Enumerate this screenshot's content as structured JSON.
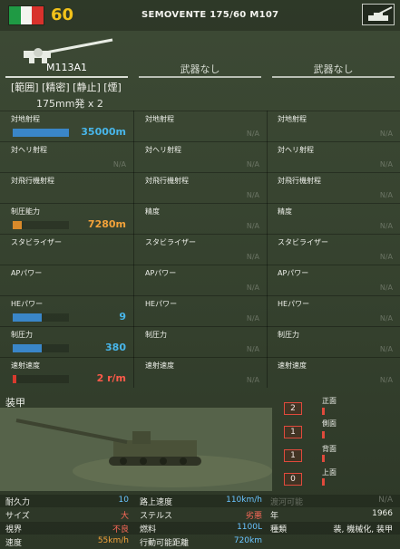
{
  "colors": {
    "accent_blue": "#3a86c8",
    "accent_orange": "#d98a2a",
    "accent_red": "#d83a2e",
    "value_blue": "#48b6ea",
    "value_orange": "#f2a23a",
    "value_red": "#ff5a4a",
    "cost_yellow": "#f2c21a",
    "good_blue": "#6ac4ff",
    "bad_red": "#ff6a5a"
  },
  "header": {
    "cost": "60",
    "unit_name": "SEMOVENTE 175/60 M107",
    "flag_icon": "italy-flag-icon",
    "unit_icon": "self-propelled-gun-icon"
  },
  "weapons": {
    "slot1": "M113A1",
    "slot2": "武器なし",
    "slot3": "武器なし",
    "tags": "[範囲] [精密] [静止] [煙]",
    "ammo": "175mm発 x 2",
    "weapon_icon": "artillery-gun-icon"
  },
  "stats": {
    "rows": [
      {
        "label": "対地射程",
        "value": "35000m",
        "bar": 0.88,
        "color": "blue"
      },
      {
        "label": "対ヘリ射程",
        "value": "N/A"
      },
      {
        "label": "対飛行機射程",
        "value": ""
      },
      {
        "label": "制圧能力",
        "value": "7280m",
        "bar": 0.14,
        "color": "orange"
      },
      {
        "label": "スタビライザー",
        "value": ""
      },
      {
        "label": "APパワー",
        "value": ""
      },
      {
        "label": "HEパワー",
        "value": "9",
        "bar": 0.46,
        "color": "blue"
      },
      {
        "label": "制圧力",
        "value": "380",
        "bar": 0.45,
        "color": "blue"
      },
      {
        "label": "速射速度",
        "value": "2 r/m",
        "bar": 0.04,
        "color": "red"
      }
    ],
    "col2": [
      {
        "label": "対地射程",
        "value": "N/A"
      },
      {
        "label": "対ヘリ射程",
        "value": "N/A"
      },
      {
        "label": "対飛行機射程",
        "value": "N/A"
      },
      {
        "label": "精度",
        "value": "N/A"
      },
      {
        "label": "スタビライザー",
        "value": "N/A"
      },
      {
        "label": "APパワー",
        "value": "N/A"
      },
      {
        "label": "HEパワー",
        "value": "N/A"
      },
      {
        "label": "制圧力",
        "value": "N/A"
      },
      {
        "label": "速射速度",
        "value": "N/A"
      }
    ],
    "col3": [
      {
        "label": "対地射程",
        "value": "N/A"
      },
      {
        "label": "対ヘリ射程",
        "value": "N/A"
      },
      {
        "label": "対飛行機射程",
        "value": "N/A"
      },
      {
        "label": "精度",
        "value": "N/A"
      },
      {
        "label": "スタビライザー",
        "value": "N/A"
      },
      {
        "label": "APパワー",
        "value": "N/A"
      },
      {
        "label": "HEパワー",
        "value": "N/A"
      },
      {
        "label": "制圧力",
        "value": "N/A"
      },
      {
        "label": "速射速度",
        "value": "N/A"
      }
    ]
  },
  "armor": {
    "title": "装甲",
    "front": {
      "label": "正面",
      "value": "2"
    },
    "side": {
      "label": "側面",
      "value": "1"
    },
    "rear": {
      "label": "背面",
      "value": "1"
    },
    "top": {
      "label": "上面",
      "value": "0"
    }
  },
  "info": {
    "durability_k": "耐久力",
    "durability_v": "10",
    "size_k": "サイズ",
    "size_v": "大",
    "vision_k": "視界",
    "vision_v": "不良",
    "speed_k": "速度",
    "speed_v": "55km/h",
    "road_k": "路上速度",
    "road_v": "110km/h",
    "stealth_k": "ステルス",
    "stealth_v": "劣悪",
    "fuel_k": "燃料",
    "fuel_v": "1100L",
    "range_k": "行動可能距離",
    "range_v": "720km",
    "amph_k": "渡河可能",
    "amph_v": "N/A",
    "year_k": "年",
    "year_v": "1966",
    "type_k": "種類",
    "type_v": "装, 機械化, 装甲"
  }
}
